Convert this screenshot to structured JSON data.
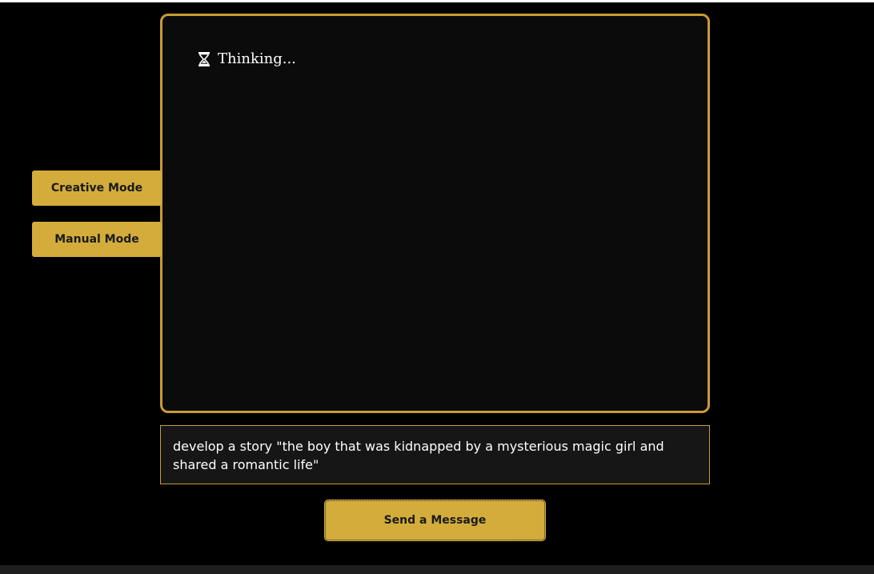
{
  "chat": {
    "status_icon": "hourglass-icon",
    "status_text": "Thinking..."
  },
  "modes": {
    "creative_label": "Creative Mode",
    "manual_label": "Manual Mode"
  },
  "input": {
    "value": "develop a story \"the boy that was kidnapped by a mysterious magic girl and shared a romantic life\""
  },
  "actions": {
    "send_label": "Send a Message"
  },
  "colors": {
    "background": "#000000",
    "accent": "#d3ac3b",
    "panel_border": "#c99b34",
    "panel_bg": "#0b0b0b",
    "text": "#ffffff"
  }
}
